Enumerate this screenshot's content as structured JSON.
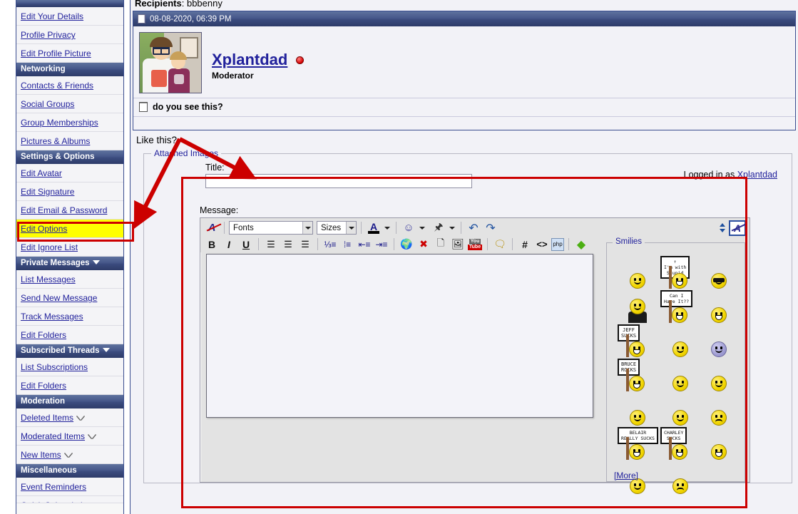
{
  "sidebar": {
    "groups": [
      {
        "type": "header-partial",
        "label": ""
      },
      {
        "type": "item",
        "label": "Edit Your Details",
        "icon": ""
      },
      {
        "type": "item",
        "label": "Profile Privacy",
        "icon": ""
      },
      {
        "type": "item",
        "label": "Edit Profile Picture",
        "icon": ""
      },
      {
        "type": "header",
        "label": "Networking",
        "caret": false
      },
      {
        "type": "item",
        "label": "Contacts & Friends",
        "icon": ""
      },
      {
        "type": "item",
        "label": "Social Groups",
        "icon": ""
      },
      {
        "type": "item",
        "label": "Group Memberships",
        "icon": ""
      },
      {
        "type": "item",
        "label": "Pictures & Albums",
        "icon": ""
      },
      {
        "type": "header",
        "label": "Settings & Options",
        "caret": false
      },
      {
        "type": "item",
        "label": "Edit Avatar",
        "icon": ""
      },
      {
        "type": "item",
        "label": "Edit Signature",
        "icon": ""
      },
      {
        "type": "item",
        "label": "Edit Email & Password",
        "icon": ""
      },
      {
        "type": "item",
        "label": "Edit Options",
        "icon": "",
        "highlighted": true
      },
      {
        "type": "item",
        "label": "Edit Ignore List",
        "icon": ""
      },
      {
        "type": "header",
        "label": "Private Messages",
        "caret": true
      },
      {
        "type": "item",
        "label": "List Messages",
        "icon": ""
      },
      {
        "type": "item",
        "label": "Send New Message",
        "icon": ""
      },
      {
        "type": "item",
        "label": "Track Messages",
        "icon": ""
      },
      {
        "type": "item",
        "label": "Edit Folders",
        "icon": ""
      },
      {
        "type": "header",
        "label": "Subscribed Threads",
        "caret": true
      },
      {
        "type": "item",
        "label": "List Subscriptions",
        "icon": ""
      },
      {
        "type": "item",
        "label": "Edit Folders",
        "icon": ""
      },
      {
        "type": "header",
        "label": "Moderation",
        "caret": false
      },
      {
        "type": "item",
        "label": "Deleted Items",
        "icon": "triangle-down-outline-icon"
      },
      {
        "type": "item",
        "label": "Moderated Items",
        "icon": "triangle-down-outline-icon"
      },
      {
        "type": "item",
        "label": "New Items",
        "icon": "triangle-down-outline-icon"
      },
      {
        "type": "header",
        "label": "Miscellaneous",
        "caret": false
      },
      {
        "type": "item",
        "label": "Event Reminders",
        "icon": ""
      },
      {
        "type": "item-partial",
        "label": "Quick Subscriptions",
        "icon": ""
      }
    ]
  },
  "main": {
    "recipients_label": "Recipients",
    "recipients_names": ": bbbenny",
    "post": {
      "timestamp": "08-08-2020, 06:39 PM",
      "author": "Xplantdad",
      "rank": "Moderator",
      "status": "online-red-dot",
      "subject": "do you see this?",
      "body": ""
    },
    "like_this": "Like this?",
    "attached_images_legend": "Attached Images",
    "title_label": "Title:",
    "title_value": "",
    "logged_in_prefix": "Logged in as ",
    "logged_in_user": "Xplantdad",
    "message_label": "Message:",
    "message_value": ""
  },
  "editor": {
    "toolbar_row1": [
      {
        "name": "remove-formatting-icon",
        "glyph": "A"
      },
      {
        "name": "font-family-select",
        "value": "Fonts"
      },
      {
        "name": "font-size-select",
        "value": "Sizes"
      },
      {
        "name": "font-color-icon",
        "glyph": "A"
      },
      {
        "name": "smilie-icon",
        "glyph": "☺"
      },
      {
        "name": "attachment-icon",
        "glyph": "📎"
      },
      {
        "name": "undo-icon",
        "glyph": "↶"
      },
      {
        "name": "redo-icon",
        "glyph": "↷"
      },
      {
        "name": "resize-editor-icon",
        "glyph": "⇕"
      },
      {
        "name": "toggle-wysiwyg-icon",
        "glyph": "A"
      }
    ],
    "toolbar_row2": [
      {
        "name": "bold-button",
        "glyph": "B"
      },
      {
        "name": "italic-button",
        "glyph": "I"
      },
      {
        "name": "underline-button",
        "glyph": "U"
      },
      {
        "name": "align-left-button",
        "glyph": "≡"
      },
      {
        "name": "align-center-button",
        "glyph": "≡"
      },
      {
        "name": "align-right-button",
        "glyph": "≡"
      },
      {
        "name": "ordered-list-button",
        "glyph": "1."
      },
      {
        "name": "unordered-list-button",
        "glyph": "•"
      },
      {
        "name": "outdent-button",
        "glyph": "⇤"
      },
      {
        "name": "indent-button",
        "glyph": "⇥"
      },
      {
        "name": "insert-link-button",
        "glyph": "🌐"
      },
      {
        "name": "remove-link-button",
        "glyph": "✖"
      },
      {
        "name": "insert-email-button",
        "glyph": "✉"
      },
      {
        "name": "insert-image-button",
        "glyph": "🖼"
      },
      {
        "name": "insert-video-button",
        "glyph": "You"
      },
      {
        "name": "insert-quote-button",
        "glyph": "❝"
      },
      {
        "name": "insert-code-button",
        "glyph": "#"
      },
      {
        "name": "insert-html-button",
        "glyph": "<>"
      },
      {
        "name": "insert-php-button",
        "glyph": "php"
      },
      {
        "name": "insert-flash-button",
        "glyph": "◆"
      }
    ],
    "fonts_placeholder": "Fonts",
    "sizes_placeholder": "Sizes"
  },
  "smilies": {
    "legend": "Smilies",
    "more_label": "[More]",
    "items": [
      {
        "type": "plain",
        "name": "smilie-confused",
        "variant": "plain"
      },
      {
        "type": "sign",
        "name": "smilie-im-with-stupid",
        "sign_text": "↑\nI'm with\nStupid"
      },
      {
        "type": "plain",
        "name": "smilie-cool",
        "variant": "cool"
      },
      {
        "type": "figure",
        "name": "smilie-bow"
      },
      {
        "type": "sign",
        "name": "smilie-can-i-have-it",
        "sign_text": "Can I\nHave It??"
      },
      {
        "type": "plain",
        "name": "smilie-grin",
        "variant": "grin"
      },
      {
        "type": "sign",
        "name": "smilie-jeff-sucks",
        "sign_text": "JEFF\nSUCKS"
      },
      {
        "type": "plain",
        "name": "smilie-surprised",
        "variant": "plain"
      },
      {
        "type": "plain",
        "name": "smilie-ghost",
        "variant": "purple"
      },
      {
        "type": "sign",
        "name": "smilie-bruce-rocks",
        "sign_text": "BRUCE\nROCKS"
      },
      {
        "type": "plain",
        "name": "smilie-squeeze",
        "variant": "plain"
      },
      {
        "type": "plain",
        "name": "smilie-dart",
        "variant": "plain"
      },
      {
        "type": "plain",
        "name": "smilie-eek",
        "variant": "plain"
      },
      {
        "type": "plain",
        "name": "smilie-thumbsup",
        "variant": "plain"
      },
      {
        "type": "plain",
        "name": "smilie-sick",
        "variant": "sad"
      },
      {
        "type": "sign",
        "name": "smilie-belair-really-sucks",
        "sign_text": "BELAIR\nREALLY SUCKS"
      },
      {
        "type": "sign",
        "name": "smilie-charley-sucks",
        "sign_text": "CHARLEY\nSUCKS"
      },
      {
        "type": "plain",
        "name": "smilie-teeth",
        "variant": "grin"
      },
      {
        "type": "plain",
        "name": "smilie-smile",
        "variant": "plain"
      },
      {
        "type": "plain",
        "name": "smilie-confused-question",
        "variant": "sad"
      },
      {
        "type": "empty",
        "name": "smilie-empty"
      }
    ]
  },
  "annotations": {
    "highlight_color": "#FFFF00",
    "marker_color": "#CC0000"
  }
}
